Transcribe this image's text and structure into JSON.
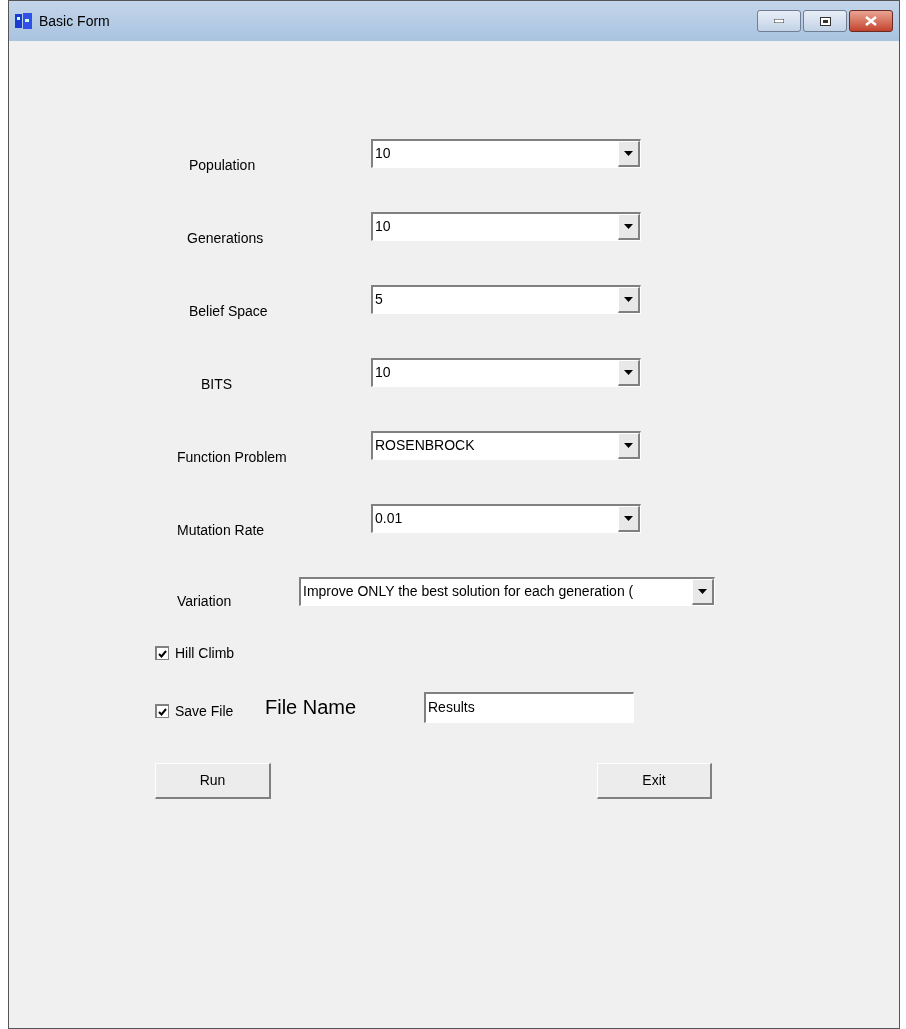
{
  "window": {
    "title": "Basic Form"
  },
  "fields": [
    {
      "label": "Population",
      "value": "10"
    },
    {
      "label": "Generations",
      "value": "10"
    },
    {
      "label": "Belief Space",
      "value": "5"
    },
    {
      "label": "BITS",
      "value": "10"
    },
    {
      "label": "Function Problem",
      "value": "ROSENBROCK"
    },
    {
      "label": "Mutation Rate",
      "value": "0.01"
    },
    {
      "label": "Variation",
      "value": "Improve ONLY the best solution for each generation ("
    }
  ],
  "checkboxes": [
    {
      "label": "Hill Climb",
      "checked": true
    },
    {
      "label": "Save File",
      "checked": true
    }
  ],
  "file_name": {
    "label": "File Name",
    "value": "Results"
  },
  "buttons": [
    "Run",
    "Exit"
  ]
}
